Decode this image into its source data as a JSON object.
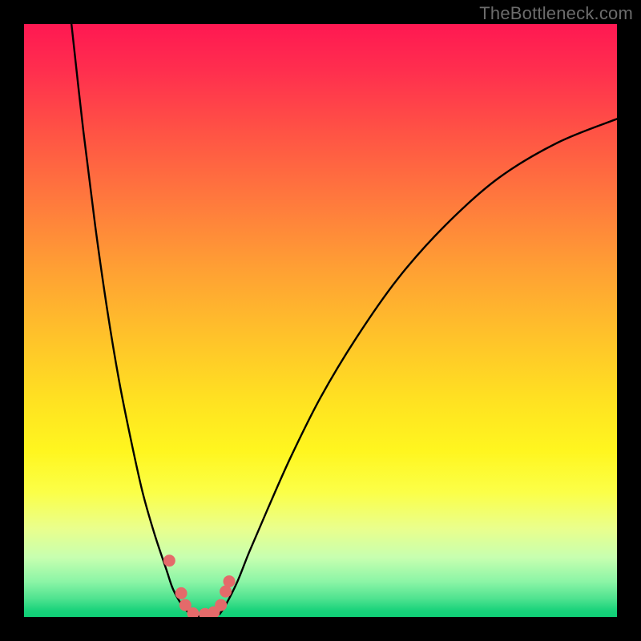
{
  "watermark": "TheBottleneck.com",
  "chart_data": {
    "type": "line",
    "title": "",
    "xlabel": "",
    "ylabel": "",
    "xlim": [
      0,
      100
    ],
    "ylim": [
      0,
      100
    ],
    "grid": false,
    "legend": false,
    "background_gradient": {
      "direction": "vertical",
      "stops": [
        {
          "pos": 0.0,
          "color": "#ff1852"
        },
        {
          "pos": 0.3,
          "color": "#ff7a3d"
        },
        {
          "pos": 0.55,
          "color": "#ffc629"
        },
        {
          "pos": 0.72,
          "color": "#fff61f"
        },
        {
          "pos": 0.9,
          "color": "#c7ffb0"
        },
        {
          "pos": 1.0,
          "color": "#0fcf76"
        }
      ]
    },
    "series": [
      {
        "name": "left-arm-curve",
        "stroke": "#000000",
        "x": [
          8,
          10,
          12,
          14,
          16,
          18,
          20,
          22,
          24,
          25,
          26,
          27,
          28
        ],
        "y": [
          100,
          82,
          66,
          52,
          40,
          30,
          21,
          14,
          8,
          5,
          3,
          1.5,
          0.5
        ]
      },
      {
        "name": "right-arm-curve",
        "stroke": "#000000",
        "x": [
          33,
          34,
          36,
          38,
          41,
          45,
          50,
          56,
          63,
          71,
          80,
          90,
          100
        ],
        "y": [
          0.5,
          2,
          6,
          11,
          18,
          27,
          37,
          47,
          57,
          66,
          74,
          80,
          84
        ]
      },
      {
        "name": "valley-floor",
        "stroke": "#000000",
        "x": [
          27.5,
          28.5,
          30,
          31.5,
          32.5
        ],
        "y": [
          1,
          0.3,
          0.1,
          0.3,
          1
        ]
      }
    ],
    "markers": {
      "name": "bottleneck-points",
      "color": "#e46a6a",
      "points": [
        {
          "x": 24.5,
          "y": 9.5
        },
        {
          "x": 26.5,
          "y": 4.0
        },
        {
          "x": 27.2,
          "y": 2.0
        },
        {
          "x": 28.5,
          "y": 0.6
        },
        {
          "x": 30.5,
          "y": 0.5
        },
        {
          "x": 32.0,
          "y": 0.8
        },
        {
          "x": 33.2,
          "y": 2.0
        },
        {
          "x": 34.0,
          "y": 4.3
        },
        {
          "x": 34.6,
          "y": 6.0
        }
      ]
    }
  }
}
